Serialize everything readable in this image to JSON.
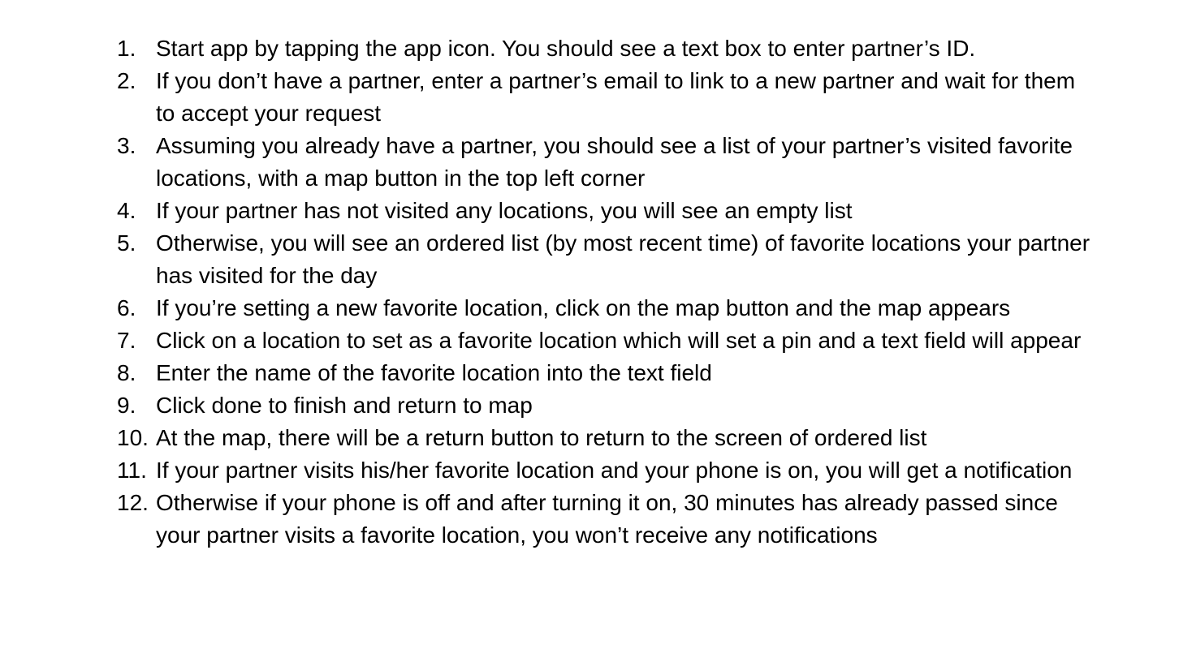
{
  "instructions": {
    "items": [
      {
        "number": "1.",
        "text": "Start app by tapping the app icon. You should see a text box to enter partner’s ID."
      },
      {
        "number": "2.",
        "text": "If you don’t have a partner, enter a partner’s email to link to a new partner and wait for them to accept your request"
      },
      {
        "number": "3.",
        "text": "Assuming you already have a partner, you should see a list of your partner’s visited favorite locations, with a map button in the top left corner"
      },
      {
        "number": "4.",
        "text": "If your partner has not visited any locations, you will see an empty list"
      },
      {
        "number": "5.",
        "text": "Otherwise, you will see an ordered list (by most recent time) of favorite locations your partner has visited for the day"
      },
      {
        "number": "6.",
        "text": "If you’re setting a new favorite location, click on the map button and the map appears"
      },
      {
        "number": "7.",
        "text": "Click on a location to set as a favorite location which will set a pin and a text field will appear"
      },
      {
        "number": "8.",
        "text": "Enter the name of the favorite location into the text field"
      },
      {
        "number": "9.",
        "text": "Click done to finish and return to map"
      },
      {
        "number": "10.",
        "text": "At the map, there will be a return button to return to the screen of ordered list"
      },
      {
        "number": "11.",
        "text": "If your partner visits his/her favorite location and your phone is on, you will get a notification"
      },
      {
        "number": "12.",
        "text": "Otherwise if your phone is off and after turning it on, 30 minutes has already passed since your partner visits a favorite location, you won’t receive any notifications"
      }
    ]
  }
}
